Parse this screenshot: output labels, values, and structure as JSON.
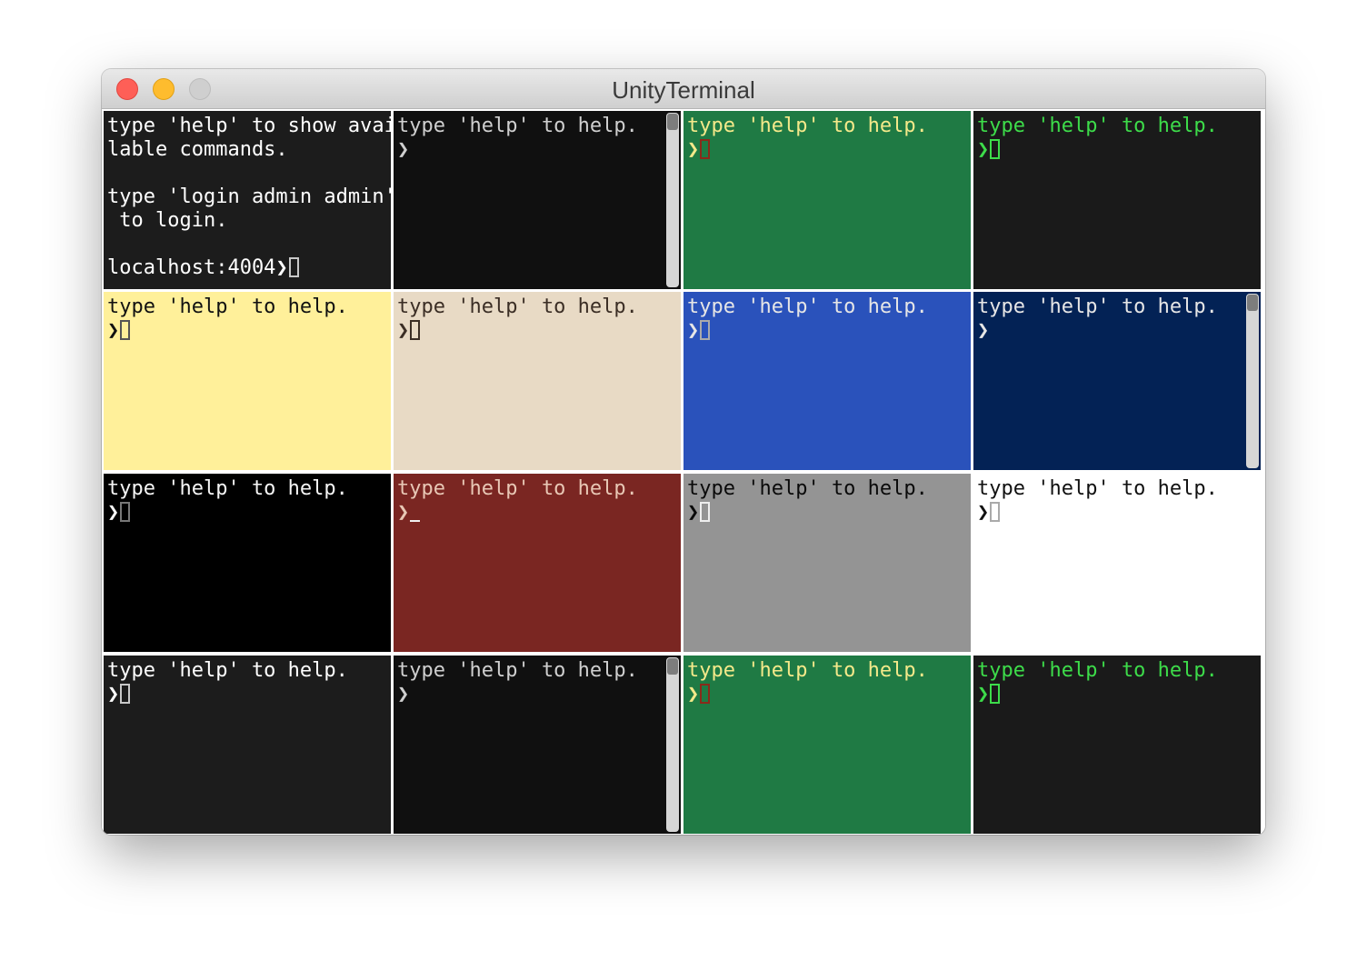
{
  "window": {
    "title": "UnityTerminal"
  },
  "panes": [
    {
      "lines": [
        "type 'help' to show avai",
        "lable commands.",
        "",
        "type 'login admin admin'",
        " to login.",
        ""
      ],
      "prompt": "localhost:4004",
      "chevron": "❯",
      "cursor": "box",
      "scrollbar": false,
      "bg": "#1c1c1c",
      "fg": "#ffffff",
      "cursor_color": "#c8c8c8"
    },
    {
      "lines": [
        "type 'help' to help."
      ],
      "prompt": "",
      "chevron": "❯",
      "cursor": "none",
      "scrollbar": true,
      "bg": "#101010",
      "fg": "#cfcfcf",
      "cursor_color": "#cfcfcf"
    },
    {
      "lines": [
        "type 'help' to help."
      ],
      "prompt": "",
      "chevron": "❯",
      "cursor": "box",
      "scrollbar": false,
      "bg": "#1f7a44",
      "fg": "#f4e98a",
      "cursor_color": "#8a2a1a"
    },
    {
      "lines": [
        "type 'help' to help."
      ],
      "prompt": "",
      "chevron": "❯",
      "cursor": "box",
      "scrollbar": false,
      "bg": "#1a1a1a",
      "fg": "#3ddc4a",
      "cursor_color": "#3ddc4a"
    },
    {
      "lines": [
        "type 'help' to help."
      ],
      "prompt": "",
      "chevron": "❯",
      "cursor": "box",
      "scrollbar": false,
      "bg": "#fff09a",
      "fg": "#111111",
      "cursor_color": "#555555"
    },
    {
      "lines": [
        "type 'help' to help."
      ],
      "prompt": "",
      "chevron": "❯",
      "cursor": "box",
      "scrollbar": false,
      "bg": "#e8dac5",
      "fg": "#3b2e25",
      "cursor_color": "#3b2e25"
    },
    {
      "lines": [
        "type 'help' to help."
      ],
      "prompt": "",
      "chevron": "❯",
      "cursor": "box",
      "scrollbar": false,
      "bg": "#2a52bb",
      "fg": "#e6e6e6",
      "cursor_color": "#aaaaaa"
    },
    {
      "lines": [
        "type 'help' to help."
      ],
      "prompt": "",
      "chevron": "❯",
      "cursor": "none",
      "scrollbar": true,
      "bg": "#032255",
      "fg": "#e6e6e6",
      "cursor_color": "#e6e6e6"
    },
    {
      "lines": [
        "type 'help' to help."
      ],
      "prompt": "",
      "chevron": "❯",
      "cursor": "box",
      "scrollbar": false,
      "bg": "#000000",
      "fg": "#f5f5f5",
      "cursor_color": "#777777"
    },
    {
      "lines": [
        "type 'help' to help."
      ],
      "prompt": "",
      "chevron": "❯",
      "cursor": "underscore",
      "scrollbar": false,
      "bg": "#7a2622",
      "fg": "#e8c7b5",
      "cursor_color": "#f0f0f0"
    },
    {
      "lines": [
        "type 'help' to help."
      ],
      "prompt": "",
      "chevron": "❯",
      "cursor": "box",
      "scrollbar": false,
      "bg": "#949494",
      "fg": "#0a0a0a",
      "cursor_color": "#eeeeee"
    },
    {
      "lines": [
        "type 'help' to help."
      ],
      "prompt": "",
      "chevron": "❯",
      "cursor": "box",
      "scrollbar": false,
      "bg": "#ffffff",
      "fg": "#111111",
      "cursor_color": "#aaaaaa"
    },
    {
      "lines": [
        "type 'help' to help."
      ],
      "prompt": "",
      "chevron": "❯",
      "cursor": "box",
      "scrollbar": false,
      "bg": "#1c1c1c",
      "fg": "#ffffff",
      "cursor_color": "#c8c8c8"
    },
    {
      "lines": [
        "type 'help' to help."
      ],
      "prompt": "",
      "chevron": "❯",
      "cursor": "none",
      "scrollbar": true,
      "bg": "#101010",
      "fg": "#cfcfcf",
      "cursor_color": "#cfcfcf"
    },
    {
      "lines": [
        "type 'help' to help."
      ],
      "prompt": "",
      "chevron": "❯",
      "cursor": "box",
      "scrollbar": false,
      "bg": "#1f7a44",
      "fg": "#f4e98a",
      "cursor_color": "#8a2a1a"
    },
    {
      "lines": [
        "type 'help' to help."
      ],
      "prompt": "",
      "chevron": "❯",
      "cursor": "box",
      "scrollbar": false,
      "bg": "#1a1a1a",
      "fg": "#3ddc4a",
      "cursor_color": "#3ddc4a"
    }
  ]
}
